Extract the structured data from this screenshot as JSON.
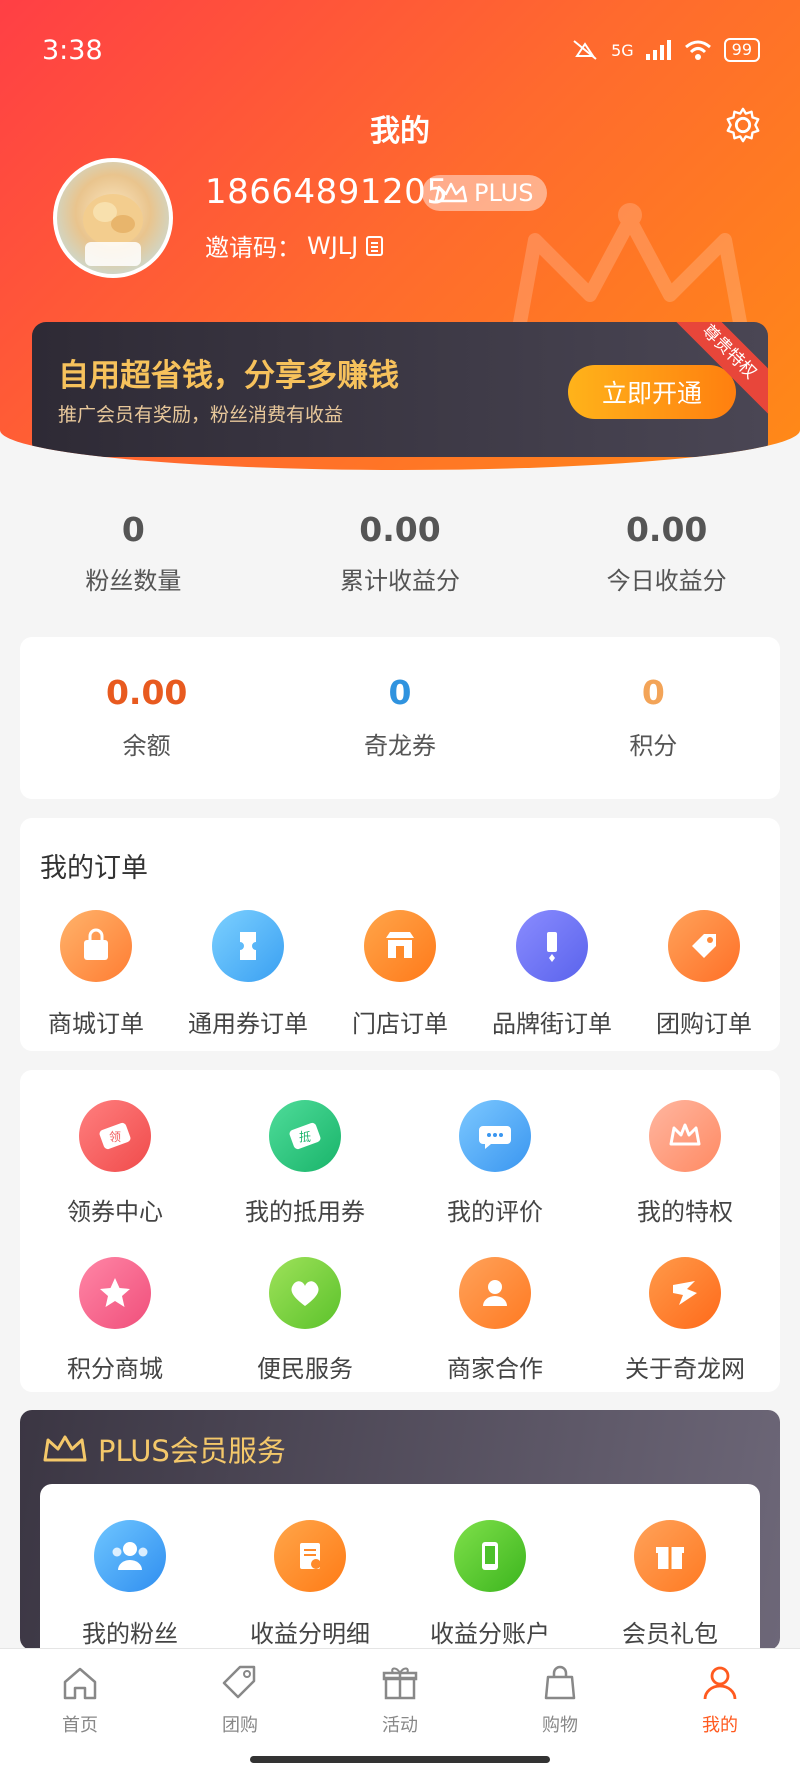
{
  "status_bar": {
    "time": "3:38",
    "network": "5G",
    "battery": "99"
  },
  "header": {
    "title": "我的",
    "phone": "18664891205",
    "badge": "PLUS",
    "invite_label": "邀请码：",
    "invite_code": "WJLJ"
  },
  "promo": {
    "headline": "自用超省钱，分享多赚钱",
    "sub": "推广会员有奖励，粉丝消费有收益",
    "button": "立即开通",
    "ribbon": "尊贵特权"
  },
  "stats": [
    {
      "value": "0",
      "label": "粉丝数量"
    },
    {
      "value": "0.00",
      "label": "累计收益分"
    },
    {
      "value": "0.00",
      "label": "今日收益分"
    }
  ],
  "wallet": [
    {
      "value": "0.00",
      "label": "余额",
      "color": "#e85a1f"
    },
    {
      "value": "0",
      "label": "奇龙券",
      "color": "#2f93df"
    },
    {
      "value": "0",
      "label": "积分",
      "color": "#f3a458"
    }
  ],
  "orders": {
    "title": "我的订单",
    "items": [
      {
        "label": "商城订单",
        "icon": "bag-icon"
      },
      {
        "label": "通用券订单",
        "icon": "ticket-icon"
      },
      {
        "label": "门店订单",
        "icon": "store-icon"
      },
      {
        "label": "品牌街订单",
        "icon": "flag-icon"
      },
      {
        "label": "团购订单",
        "icon": "tag-icon"
      }
    ]
  },
  "services": [
    {
      "label": "领券中心",
      "icon": "coupon-icon",
      "glyph": "领"
    },
    {
      "label": "我的抵用券",
      "icon": "voucher-icon",
      "glyph": "抵"
    },
    {
      "label": "我的评价",
      "icon": "chat-icon"
    },
    {
      "label": "我的特权",
      "icon": "crown-icon"
    },
    {
      "label": "积分商城",
      "icon": "star-icon"
    },
    {
      "label": "便民服务",
      "icon": "heart-icon"
    },
    {
      "label": "商家合作",
      "icon": "user-icon"
    },
    {
      "label": "关于奇龙网",
      "icon": "logo-icon"
    }
  ],
  "plus": {
    "title": "PLUS会员服务",
    "items": [
      {
        "label": "我的粉丝",
        "icon": "fans-icon"
      },
      {
        "label": "收益分明细",
        "icon": "receipt-icon"
      },
      {
        "label": "收益分账户",
        "icon": "phone-icon"
      },
      {
        "label": "会员礼包",
        "icon": "gift-icon"
      }
    ]
  },
  "nav": [
    {
      "label": "首页",
      "icon": "home-icon",
      "active": false
    },
    {
      "label": "团购",
      "icon": "tag-icon",
      "active": false
    },
    {
      "label": "活动",
      "icon": "gift-icon",
      "active": false
    },
    {
      "label": "购物",
      "icon": "shopping-bag-icon",
      "active": false
    },
    {
      "label": "我的",
      "icon": "person-icon",
      "active": true
    }
  ]
}
